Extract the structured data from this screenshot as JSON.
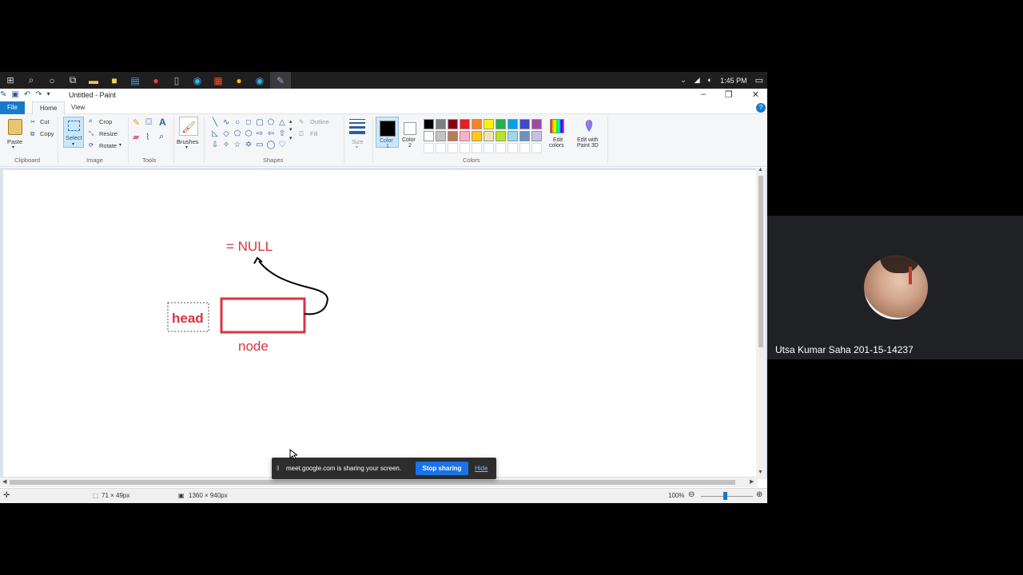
{
  "taskbar": {
    "icons": [
      "windows-start-icon",
      "search-icon",
      "cortana-icon",
      "task-view-icon",
      "file-explorer-icon",
      "sticky-notes-icon",
      "app-icon",
      "chrome-icon",
      "file-icon",
      "edge-icon",
      "app-grid-icon",
      "chrome-icon",
      "edge-icon",
      "paint-icon"
    ],
    "time": "1:45 PM"
  },
  "window": {
    "title": "Untitled - Paint",
    "minimize": "–",
    "restore": "❐",
    "close": "✕"
  },
  "tabs": {
    "file": "File",
    "home": "Home",
    "view": "View"
  },
  "ribbon": {
    "clipboard": {
      "paste": "Paste",
      "cut": "Cut",
      "copy": "Copy",
      "label": "Clipboard"
    },
    "image": {
      "select": "Select",
      "crop": "Crop",
      "resize": "Resize",
      "rotate": "Rotate",
      "label": "Image"
    },
    "tools": {
      "label": "Tools"
    },
    "brushes": {
      "label": "Brushes"
    },
    "shapes": {
      "outline": "Outline",
      "fill": "Fill",
      "label": "Shapes"
    },
    "size": {
      "label": "Size"
    },
    "colors": {
      "color1": "Color\n1",
      "color1_line1": "Color",
      "color1_line2": "1",
      "color2_line1": "Color",
      "color2_line2": "2",
      "edit_colors_line1": "Edit",
      "edit_colors_line2": "colors",
      "paint3d_line1": "Edit with",
      "paint3d_line2": "Paint 3D",
      "label": "Colors",
      "palette": [
        "#000000",
        "#7f7f7f",
        "#880015",
        "#ed1c24",
        "#ff7f27",
        "#fff200",
        "#22b14c",
        "#00a2e8",
        "#3f48cc",
        "#a349a4",
        "#ffffff",
        "#c3c3c3",
        "#b97a57",
        "#ffaec9",
        "#ffc90e",
        "#efe4b0",
        "#b5e61d",
        "#99d9ea",
        "#7092be",
        "#c8bfe7"
      ]
    }
  },
  "drawing": {
    "null_label": "= NULL",
    "head_label": "head",
    "node_label": "node"
  },
  "status": {
    "selection_size": "71 × 49px",
    "canvas_size": "1360 × 940px",
    "zoom": "100%"
  },
  "share_banner": {
    "message": "meet.google.com is sharing your screen.",
    "stop": "Stop sharing",
    "hide": "Hide"
  },
  "participant": {
    "name": "Utsa Kumar Saha 201-15-14237"
  }
}
